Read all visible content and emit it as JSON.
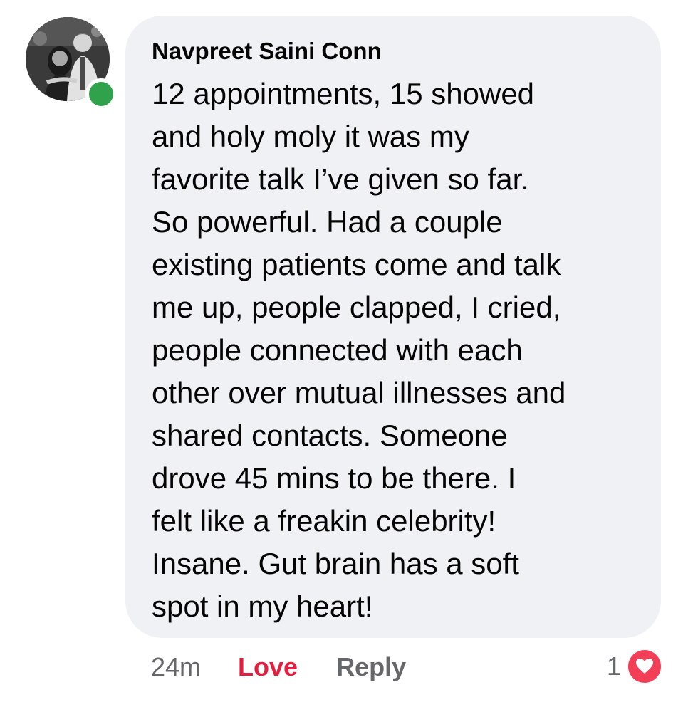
{
  "comment": {
    "author": "Navpreet Saini Conn",
    "text_lines": [
      "12 appointments, 15 showed",
      "and holy moly it was my",
      "favorite talk I’ve given so far.",
      "So powerful. Had a couple",
      "existing patients come and talk",
      "me up, people clapped, I cried,",
      "people connected with each",
      "other over mutual illnesses and",
      "shared contacts. Someone",
      "drove 45 mins to be there. I",
      "felt like a freakin celebrity!",
      "Insane. Gut brain has a soft",
      "spot in my heart!"
    ],
    "online_status": "online"
  },
  "actions": {
    "timestamp": "24m",
    "love_label": "Love",
    "reply_label": "Reply"
  },
  "reactions": {
    "count": "1",
    "icon": "heart-icon"
  },
  "colors": {
    "bubble_background": "#f0f1f4",
    "text": "#050505",
    "secondary_text": "#65676b",
    "love": "#e41e3f",
    "love_reaction": "#f33e58",
    "online_dot": "#31a24c"
  }
}
